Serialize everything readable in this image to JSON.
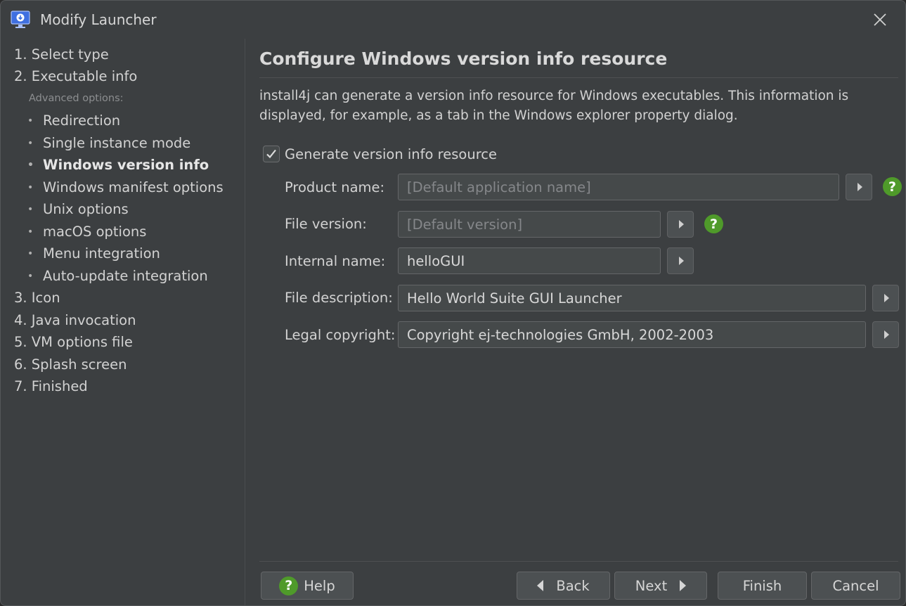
{
  "window": {
    "title": "Modify Launcher",
    "accent": "#3f6fe0"
  },
  "sidebar": {
    "steps_top": [
      {
        "label": "1. Select type"
      },
      {
        "label": "2. Executable info"
      }
    ],
    "advanced_label": "Advanced options:",
    "sub_items": [
      {
        "label": "Redirection",
        "active": false
      },
      {
        "label": "Single instance mode",
        "active": false
      },
      {
        "label": "Windows version info",
        "active": true
      },
      {
        "label": "Windows manifest options",
        "active": false
      },
      {
        "label": "Unix options",
        "active": false
      },
      {
        "label": "macOS options",
        "active": false
      },
      {
        "label": "Menu integration",
        "active": false
      },
      {
        "label": "Auto-update integration",
        "active": false
      }
    ],
    "steps_bottom": [
      {
        "label": "3. Icon"
      },
      {
        "label": "4. Java invocation"
      },
      {
        "label": "5. VM options file"
      },
      {
        "label": "6. Splash screen"
      },
      {
        "label": "7. Finished"
      }
    ]
  },
  "main": {
    "title": "Configure Windows version info resource",
    "description": "install4j can generate a version info resource for Windows executables. This information is displayed, for example, as a tab in the Windows explorer property dialog.",
    "checkbox": {
      "label": "Generate version info resource",
      "checked": true
    },
    "fields": {
      "product_name": {
        "label": "Product name:",
        "value": "",
        "placeholder": "[Default application name]"
      },
      "file_version": {
        "label": "File version:",
        "value": "",
        "placeholder": "[Default version]"
      },
      "internal_name": {
        "label": "Internal name:",
        "value": "helloGUI"
      },
      "file_description": {
        "label": "File description:",
        "value": "Hello World Suite GUI Launcher"
      },
      "legal_copyright": {
        "label": "Legal copyright:",
        "value": "Copyright ej-technologies GmbH, 2002-2003"
      }
    },
    "help_glyph": "?"
  },
  "buttons": {
    "help": "Help",
    "back": "Back",
    "next": "Next",
    "finish": "Finish",
    "cancel": "Cancel"
  },
  "colors": {
    "help_green": "#4f9a2a",
    "background": "#3c3f41"
  }
}
